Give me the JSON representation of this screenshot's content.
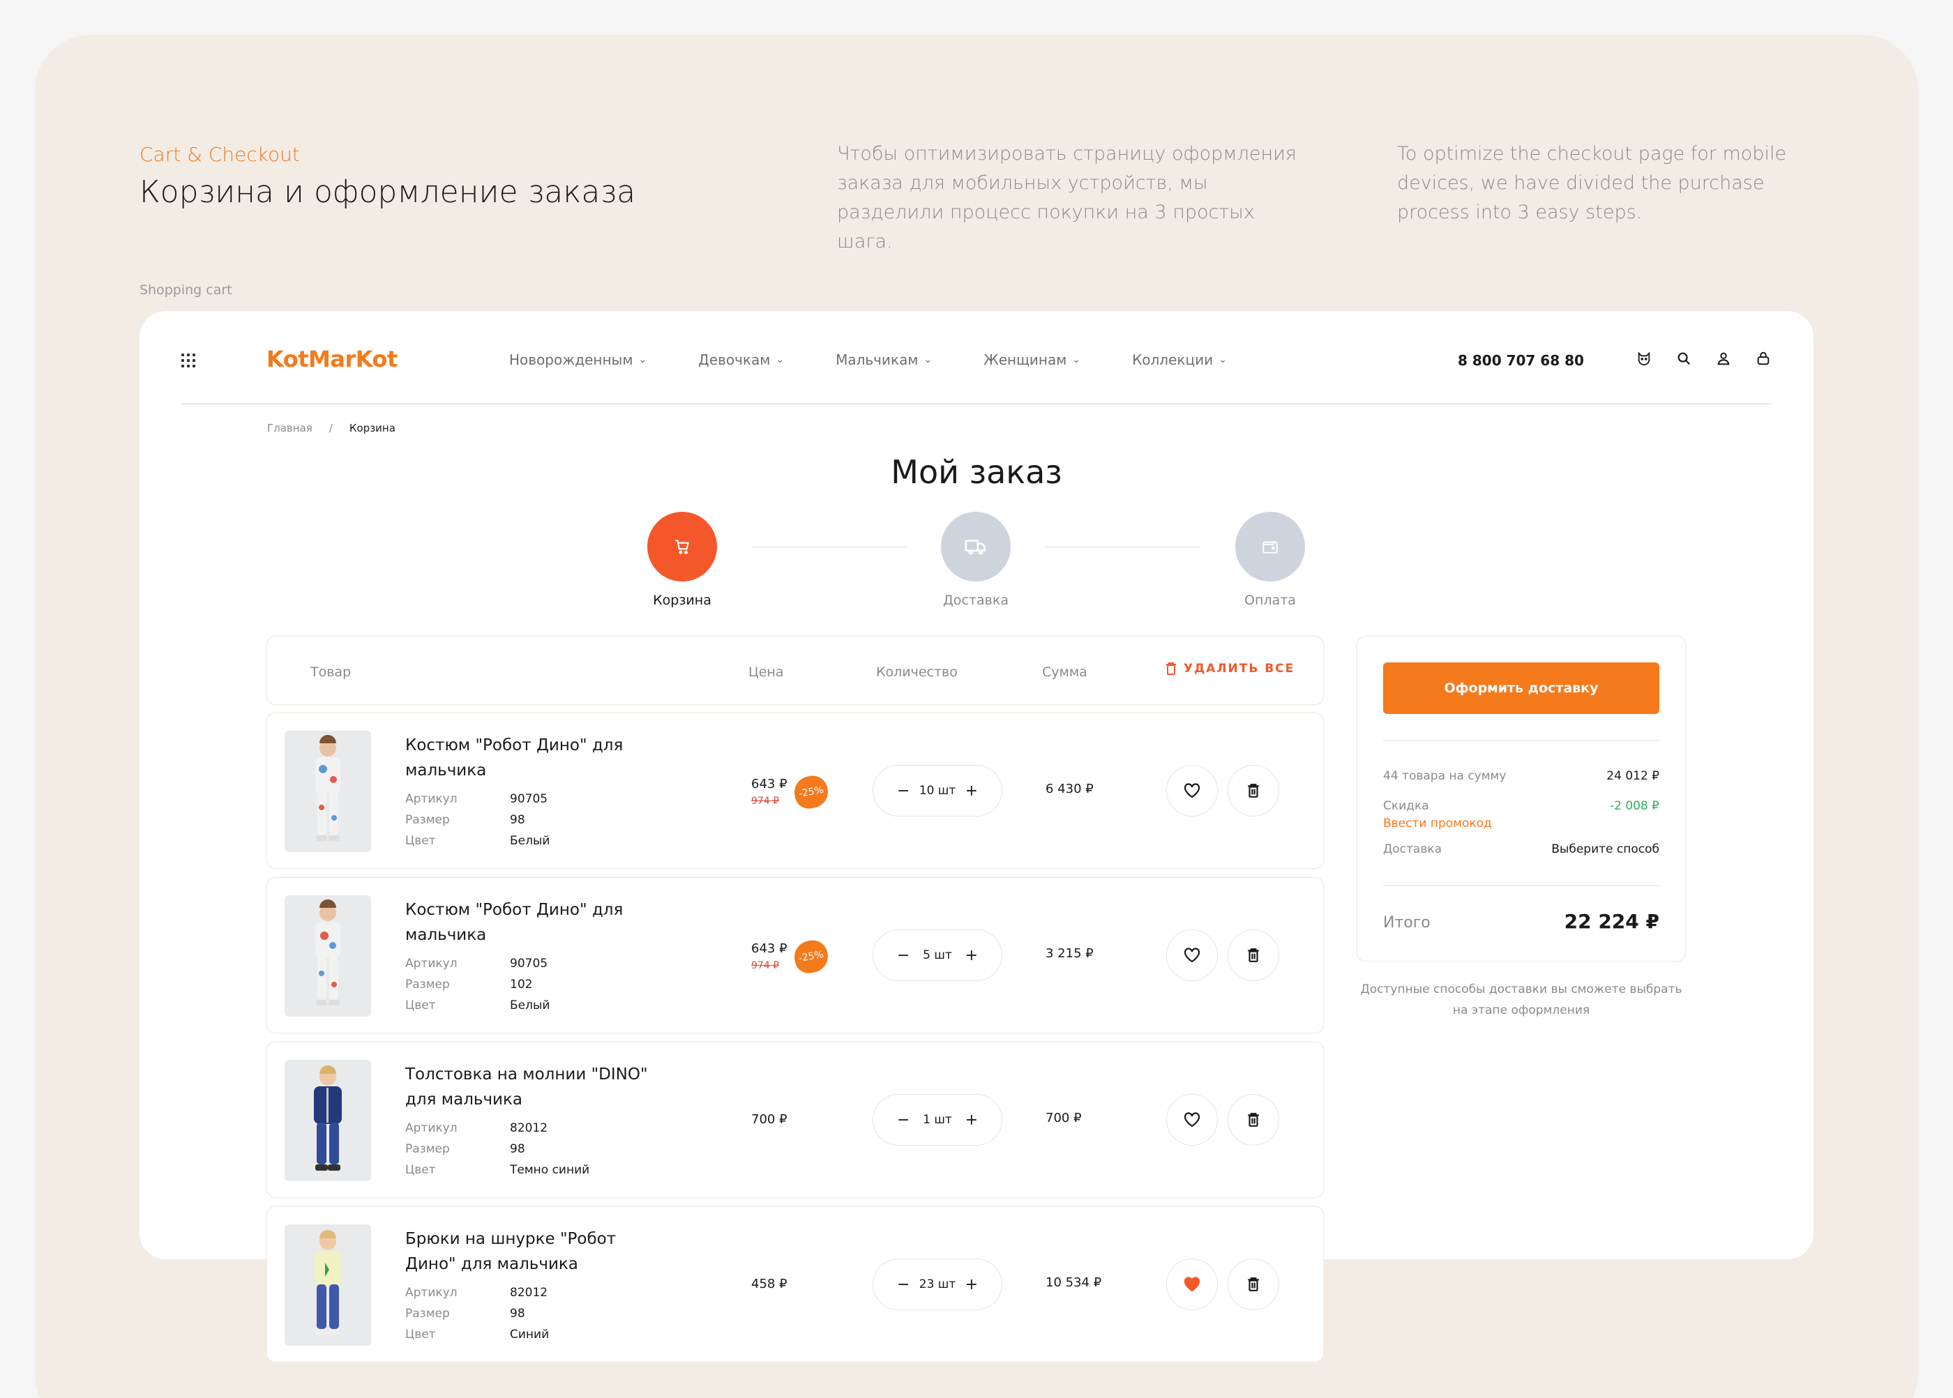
{
  "intro": {
    "eyebrow": "Cart & Checkout",
    "headline": "Корзина и оформление заказа",
    "desc_ru": "Чтобы оптимизировать страницу оформления заказа для мобильных устройств, мы разделили процесс покупки на 3 простых шага.",
    "desc_en": "To optimize the checkout page for mobile devices, we have divided the purchase process into 3 easy steps.",
    "caption": "Shopping cart"
  },
  "header": {
    "logo": "KotMarKot",
    "nav": [
      {
        "label": "Новорожденным"
      },
      {
        "label": "Девочкам"
      },
      {
        "label": "Мальчикам"
      },
      {
        "label": "Женщинам"
      },
      {
        "label": "Коллекции"
      }
    ],
    "phone": "8 800 707 68 80"
  },
  "breadcrumb": {
    "home": "Главная",
    "separator": "/",
    "current": "Корзина"
  },
  "page_title": "Мой заказ",
  "steps": [
    {
      "label": "Корзина",
      "active": true
    },
    {
      "label": "Доставка",
      "active": false
    },
    {
      "label": "Оплата",
      "active": false
    }
  ],
  "table": {
    "headers": {
      "product": "Товар",
      "price": "Цена",
      "quantity": "Количество",
      "sum": "Сумма"
    },
    "delete_all": "Удалить все",
    "attr_labels": {
      "article": "Артикул",
      "size": "Размер",
      "color": "Цвет"
    },
    "rows": [
      {
        "name": "Костюм \"Робот Дино\" для мальчика",
        "article": "90705",
        "size": "98",
        "color": "Белый",
        "price": "643 ₽",
        "old_price": "974 ₽",
        "badge": "-25%",
        "qty": "10 шт",
        "sum": "6 430 ₽",
        "favorite": false
      },
      {
        "name": "Костюм \"Робот Дино\" для мальчика",
        "article": "90705",
        "size": "102",
        "color": "Белый",
        "price": "643 ₽",
        "old_price": "974 ₽",
        "badge": "-25%",
        "qty": "5 шт",
        "sum": "3 215 ₽",
        "favorite": false
      },
      {
        "name": "Толстовка на молнии \"DINO\" для мальчика",
        "article": "82012",
        "size": "98",
        "color": "Темно синий",
        "price": "700 ₽",
        "qty": "1 шт",
        "sum": "700 ₽",
        "favorite": false
      },
      {
        "name": "Брюки на шнурке \"Робот Дино\" для мальчика",
        "article": "82012",
        "size": "98",
        "color": "Синий",
        "price": "458 ₽",
        "qty": "23 шт",
        "sum": "10 534 ₽",
        "favorite": true
      }
    ]
  },
  "summary": {
    "cta": "Оформить доставку",
    "items_label": "44 товара на сумму",
    "items_value": "24 012 ₽",
    "discount_label": "Скидка",
    "discount_value": "-2 008 ₽",
    "promo_link": "Ввести промокод",
    "delivery_label": "Доставка",
    "delivery_value": "Выберите способ",
    "total_label": "Итого",
    "total_value": "22 224 ₽",
    "note": "Доступные способы доставки вы сможете выбрать на этапе оформления"
  },
  "colors": {
    "accent": "#f47a1c",
    "step_active": "#f4572a",
    "step_inactive": "#cfd3de",
    "discount": "#2fae5a",
    "favorite": "#f4572a"
  },
  "icons": {
    "menu": "grid-icon",
    "cat": "cat-icon",
    "search": "search-icon",
    "user": "user-icon",
    "bag": "bag-icon",
    "cart": "cart-icon",
    "truck": "truck-icon",
    "wallet": "wallet-icon",
    "heart": "heart-icon",
    "trash": "trash-icon"
  }
}
